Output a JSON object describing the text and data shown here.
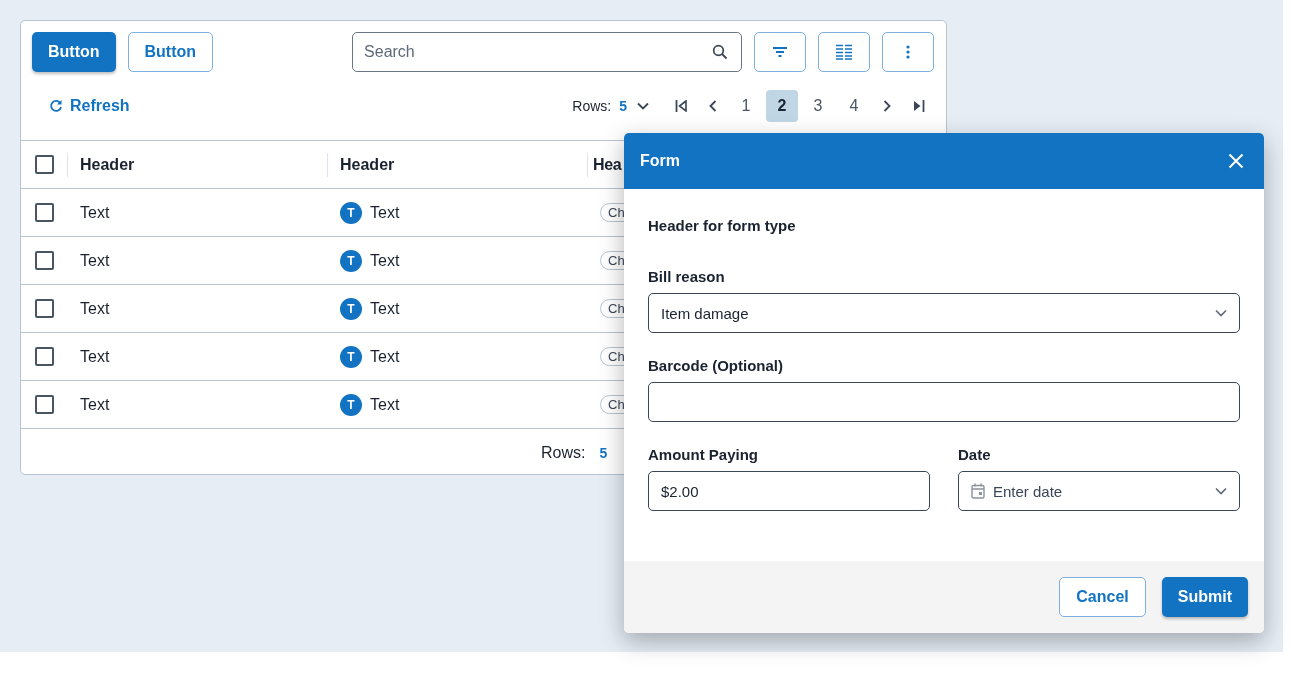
{
  "toolbar": {
    "buttons": [
      {
        "label": "Button",
        "kind": "primary"
      },
      {
        "label": "Button",
        "kind": "secondary"
      }
    ],
    "search": {
      "placeholder": "Search"
    }
  },
  "refresh": {
    "label": "Refresh"
  },
  "pagination": {
    "rows_label": "Rows:",
    "rows_value": "5",
    "pages": [
      {
        "label": "1",
        "selected": false
      },
      {
        "label": "2",
        "selected": true
      },
      {
        "label": "3",
        "selected": false
      },
      {
        "label": "4",
        "selected": false
      }
    ]
  },
  "table": {
    "select_all_checked": false,
    "columns": [
      "Header",
      "Header",
      "Hea"
    ],
    "rows": [
      {
        "checked": false,
        "text": "Text",
        "avatar": "T",
        "person": "Text",
        "chip": "Ch"
      },
      {
        "checked": false,
        "text": "Text",
        "avatar": "T",
        "person": "Text",
        "chip": "Ch"
      },
      {
        "checked": false,
        "text": "Text",
        "avatar": "T",
        "person": "Text",
        "chip": "Ch"
      },
      {
        "checked": false,
        "text": "Text",
        "avatar": "T",
        "person": "Text",
        "chip": "Ch"
      },
      {
        "checked": false,
        "text": "Text",
        "avatar": "T",
        "person": "Text",
        "chip": "Ch"
      }
    ]
  },
  "footer": {
    "rows_label": "Rows:",
    "rows_value": "5"
  },
  "dialog": {
    "title": "Form",
    "section_header": "Header for form type",
    "field_rows": [
      [
        {
          "kind": "select",
          "label": "Bill reason",
          "value": "Item damage"
        }
      ],
      [
        {
          "kind": "text",
          "label": "Barcode (Optional)"
        }
      ],
      [
        {
          "kind": "text",
          "label": "Amount Paying",
          "value": "$2.00"
        },
        {
          "kind": "date",
          "label": "Date",
          "placeholder": "Enter date"
        }
      ]
    ],
    "buttons": [
      {
        "label": "Cancel",
        "kind": "secondary"
      },
      {
        "label": "Submit",
        "kind": "primary"
      }
    ]
  }
}
